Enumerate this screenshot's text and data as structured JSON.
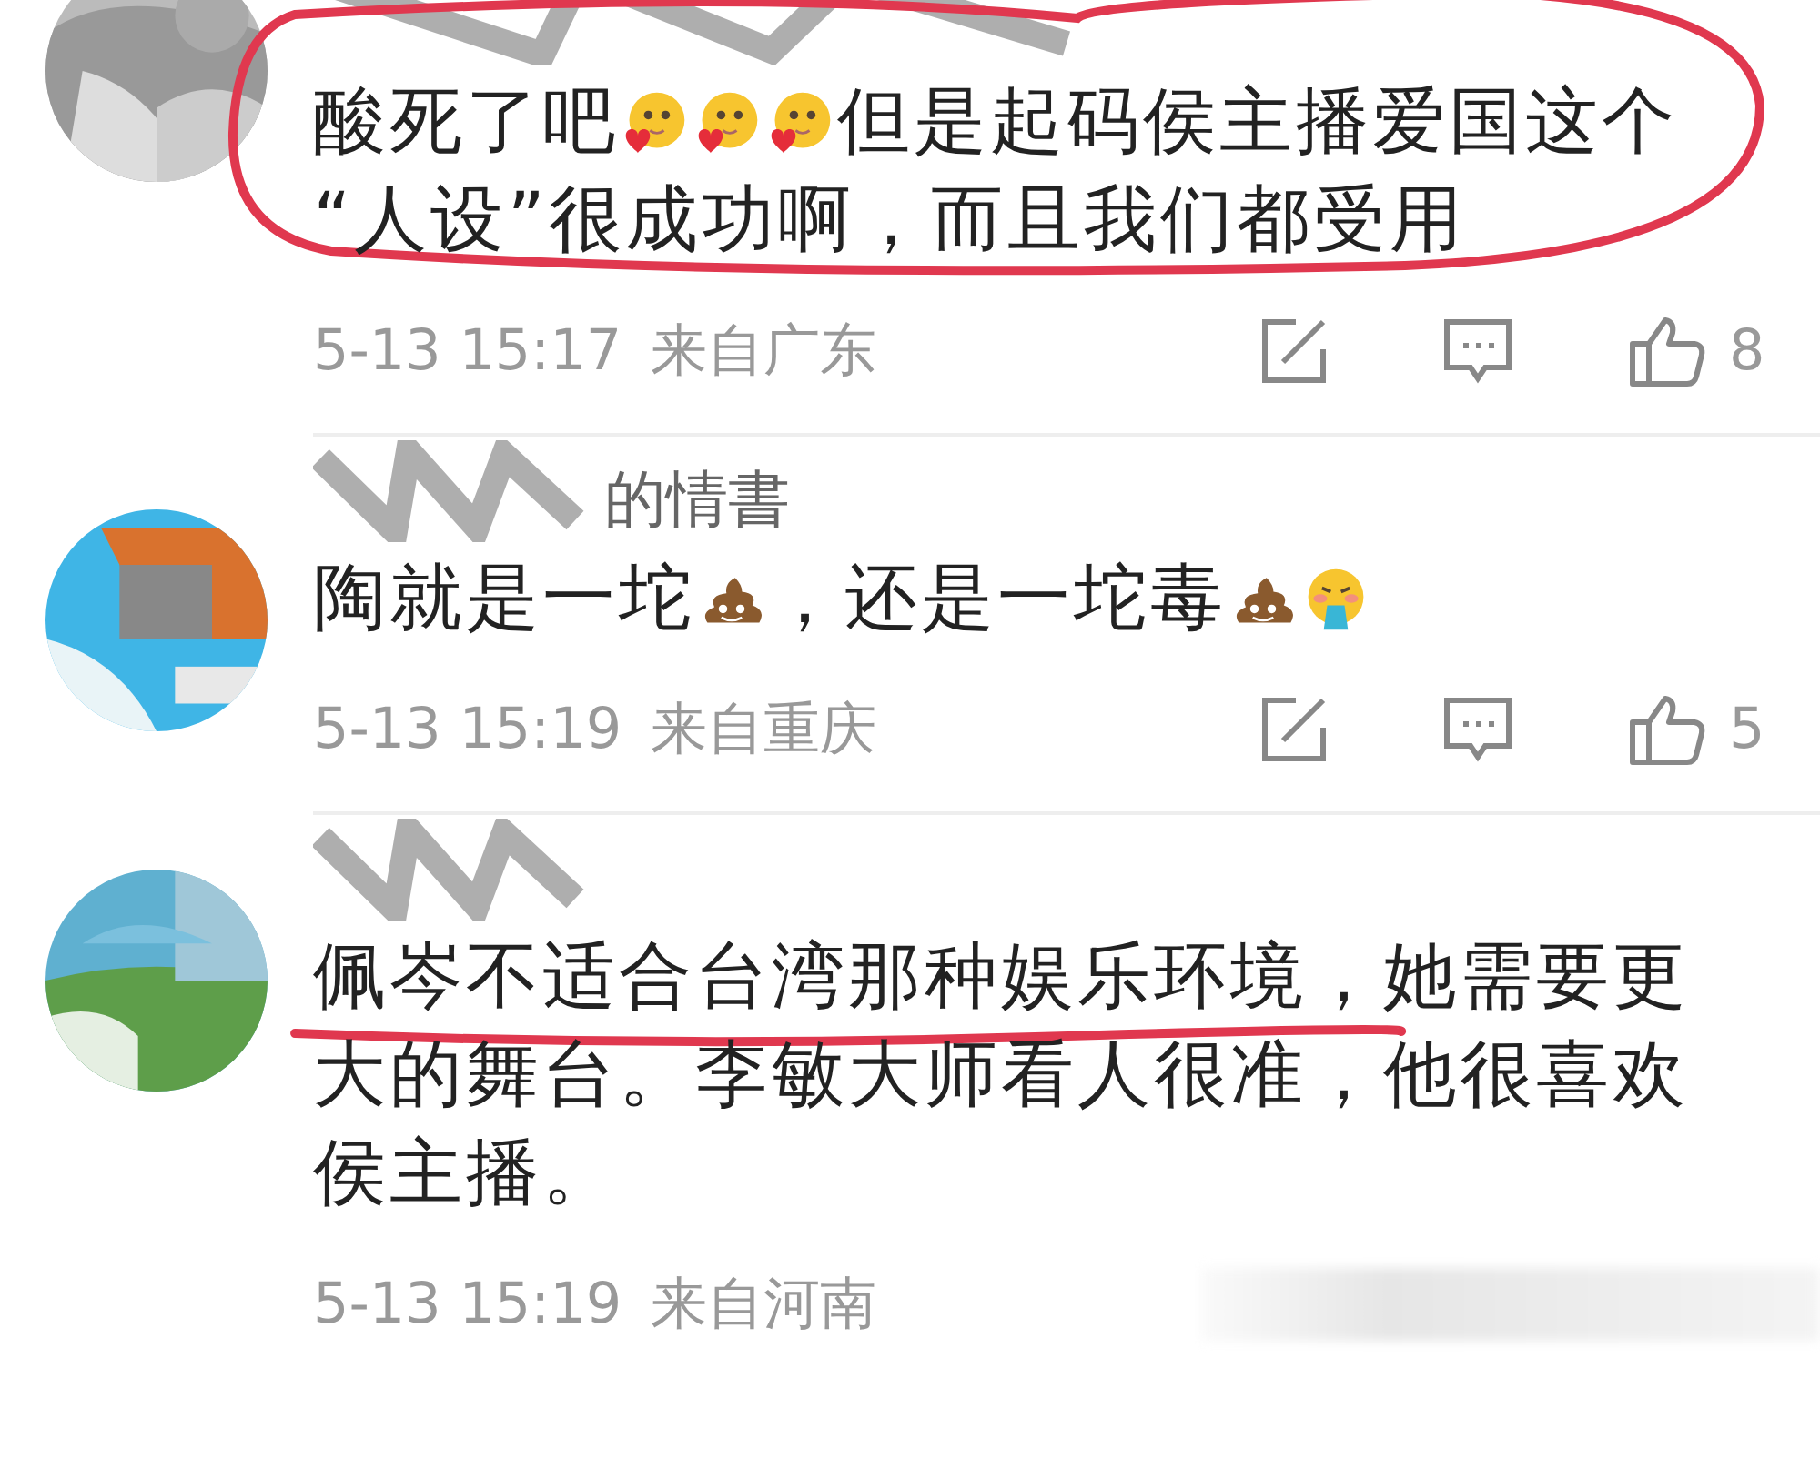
{
  "comments": [
    {
      "circled": true,
      "redacted_footer": false,
      "lines": [
        [
          {
            "kind": "text",
            "text": "酸死了吧"
          },
          {
            "kind": "blush"
          },
          {
            "kind": "blush"
          },
          {
            "kind": "blush"
          },
          {
            "kind": "text",
            "text": "但是起码侯主播爱国这个"
          }
        ],
        [
          {
            "kind": "text",
            "text": "“人设”很成功啊，而且我们都受用"
          }
        ]
      ],
      "time": "5-13 15:17",
      "location": "来自广东",
      "likes": "8"
    },
    {
      "circled": false,
      "username": "的情書",
      "redacted_footer": false,
      "lines": [
        [
          {
            "kind": "text",
            "text": "陶就是一坨"
          },
          {
            "kind": "poop"
          },
          {
            "kind": "text",
            "text": "，还是一坨毒"
          },
          {
            "kind": "poop"
          },
          {
            "kind": "vomit"
          }
        ]
      ],
      "time": "5-13 15:19",
      "location": "来自重庆",
      "likes": "5"
    },
    {
      "circled": false,
      "redacted_footer": true,
      "lines": [
        [
          {
            "kind": "text",
            "text": "佩岑不适合台湾那种娱乐环境，",
            "underlined": true
          },
          {
            "kind": "text",
            "text": "她需要更",
            "underlined": false
          }
        ],
        [
          {
            "kind": "text",
            "text": "大的舞台。李敏大师看人很准，他很喜欢"
          }
        ],
        [
          {
            "kind": "text",
            "text": "侯主播。"
          }
        ]
      ],
      "time": "5-13 15:19",
      "location": "来自河南"
    }
  ]
}
